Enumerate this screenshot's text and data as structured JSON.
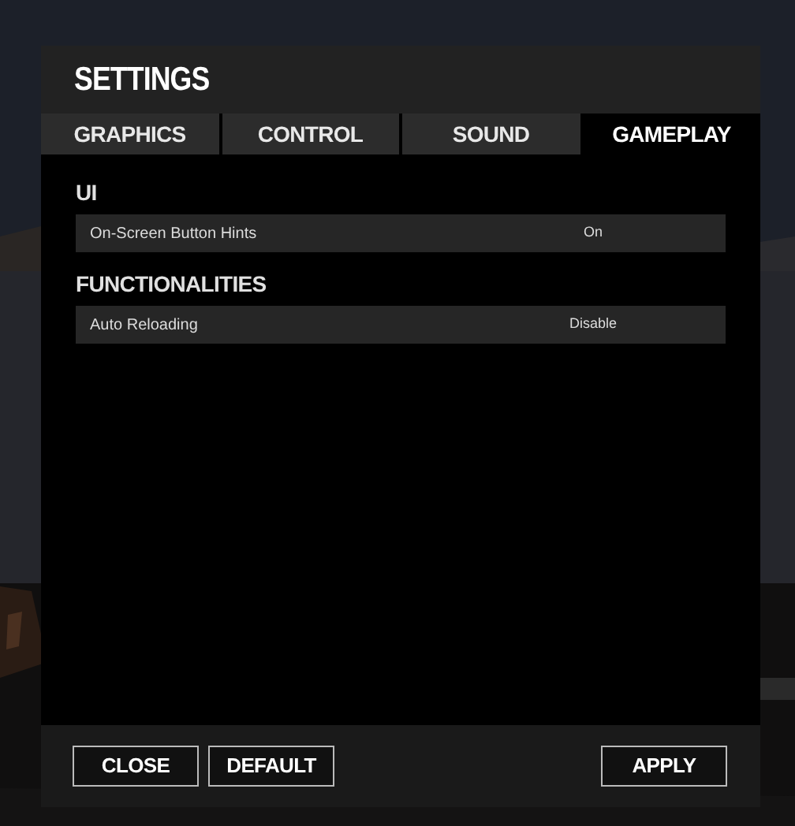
{
  "window": {
    "title": "SETTINGS"
  },
  "tabs": [
    {
      "label": "GRAPHICS",
      "selected": false
    },
    {
      "label": "CONTROL",
      "selected": false
    },
    {
      "label": "SOUND",
      "selected": false
    },
    {
      "label": "GAMEPLAY",
      "selected": true
    }
  ],
  "sections": [
    {
      "heading": "UI",
      "settings": [
        {
          "label": "On-Screen Button Hints",
          "value": "On"
        }
      ]
    },
    {
      "heading": "FUNCTIONALITIES",
      "settings": [
        {
          "label": "Auto Reloading",
          "value": "Disable"
        }
      ]
    }
  ],
  "buttons": [
    {
      "label": "CLOSE"
    },
    {
      "label": "DEFAULT"
    },
    {
      "label": "APPLY"
    }
  ]
}
